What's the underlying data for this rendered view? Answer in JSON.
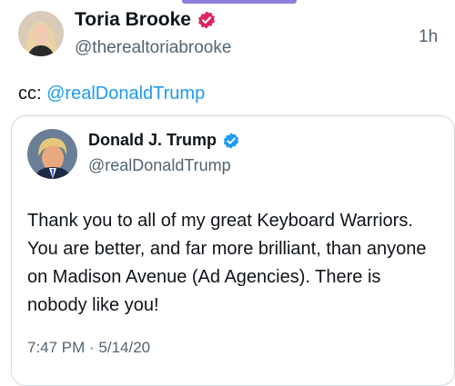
{
  "outer_post": {
    "display_name": "Toria Brooke",
    "handle": "@therealtoriabrooke",
    "time": "1h",
    "cc_prefix": "cc:",
    "cc_mention": "@realDonaldTrump",
    "verified_badge": "verified-badge-icon"
  },
  "quoted_post": {
    "display_name": "Donald J. Trump",
    "handle": "@realDonaldTrump",
    "text": "Thank you to all of my great Keyboard Warriors. You are better, and far more brilliant, than anyone on Madison Avenue (Ad Agencies). There is nobody like you!",
    "timestamp": "7:47 PM · 5/14/20",
    "verified_badge": "verified-badge-icon"
  },
  "colors": {
    "link": "#1d9bf0",
    "secondary_text": "#536471",
    "badge_pink": "#e0245e",
    "badge_blue": "#1d9bf0",
    "card_border": "#cfd9de",
    "top_indicator": "#8b7fd9"
  }
}
